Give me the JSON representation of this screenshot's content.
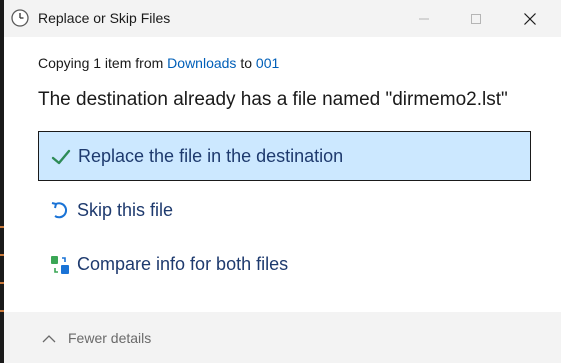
{
  "window": {
    "title": "Replace or Skip Files"
  },
  "copy_status": {
    "prefix": "Copying 1 item from ",
    "source": "Downloads",
    "middle": " to ",
    "target": "001"
  },
  "message": "The destination already has a file named \"dirmemo2.lst\"",
  "options": [
    {
      "label": "Replace the file in the destination",
      "icon": "checkmark-icon",
      "selected": true
    },
    {
      "label": "Skip this file",
      "icon": "skip-arrow-icon",
      "selected": false
    },
    {
      "label": "Compare info for both files",
      "icon": "compare-icon",
      "selected": false
    }
  ],
  "footer": {
    "details_label": "Fewer details"
  },
  "colors": {
    "accent": "#005fb8",
    "selected_bg": "#cce8ff",
    "check_green": "#2e8b57"
  }
}
